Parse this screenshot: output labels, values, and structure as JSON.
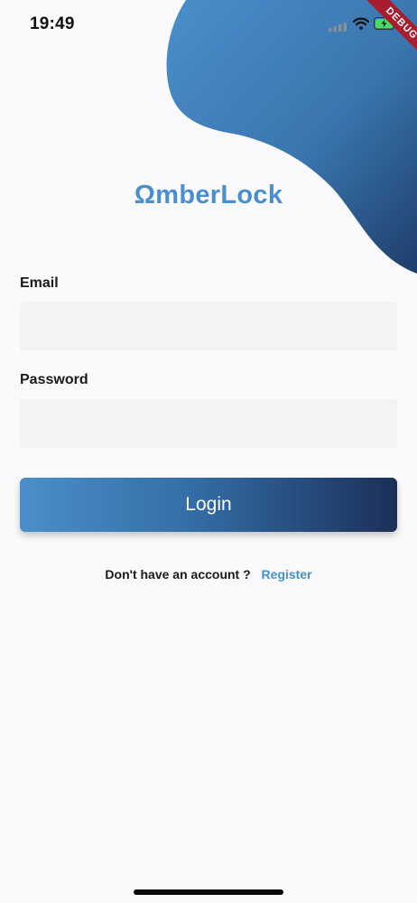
{
  "status_bar": {
    "time": "19:49"
  },
  "debug_banner": {
    "label": "DEBUG"
  },
  "logo": {
    "text": "ΩmberLock"
  },
  "form": {
    "email_label": "Email",
    "email_value": "",
    "password_label": "Password",
    "password_value": "",
    "login_label": "Login"
  },
  "register": {
    "prompt": "Don't have an account ?",
    "link_label": "Register"
  },
  "colors": {
    "brand": "#4A8FCB",
    "gradient_start": "#4A8FCB",
    "gradient_end": "#1B3058",
    "background": "#FAFAFC",
    "input_background": "#F3F3F5",
    "debug": "#A81E2E"
  },
  "icons": {
    "signal": "cellular-signal-icon",
    "wifi": "wifi-icon",
    "battery": "battery-charging-icon"
  }
}
